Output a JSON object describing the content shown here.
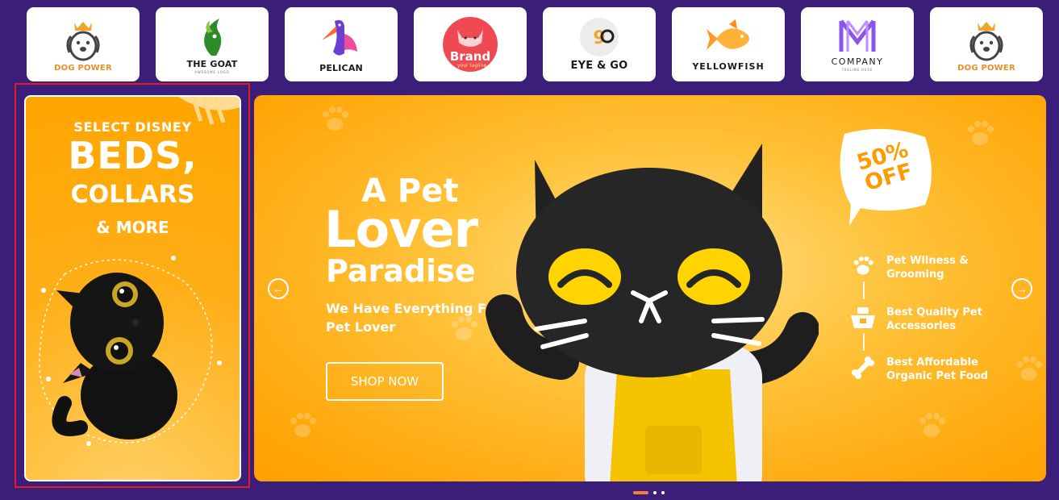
{
  "brands": [
    {
      "name": "DOG POWER",
      "tagline": "",
      "icon": "dog-crown-icon"
    },
    {
      "name": "THE GOAT",
      "tagline": "AWESOME LOGO",
      "icon": "goat-icon"
    },
    {
      "name": "PELICAN",
      "tagline": "",
      "icon": "pelican-icon"
    },
    {
      "name": "Brand",
      "tagline": "your tagline",
      "icon": "cat-face-icon"
    },
    {
      "name": "EYE & GO",
      "tagline": "",
      "icon": "eye-go-icon"
    },
    {
      "name": "YELLOWFISH",
      "tagline": "",
      "icon": "fish-icon"
    },
    {
      "name": "COMPANY",
      "tagline": "TAGLINE HERE",
      "icon": "m-logo-icon"
    },
    {
      "name": "DOG POWER",
      "tagline": "",
      "icon": "dog-crown-icon"
    }
  ],
  "side_banner": {
    "pre": "SELECT DISNEY",
    "big": "BEDS,",
    "mid": "COLLARS",
    "small": "& MORE"
  },
  "hero": {
    "line1": "A Pet",
    "line2": "Lover",
    "line3": "Paradise",
    "subtitle": "We Have Everything For Pet Lover",
    "button": "SHOP NOW",
    "badge": "50% OFF",
    "prev": "←",
    "next": "→",
    "features": [
      {
        "label": "Pet Wllness & Grooming",
        "icon": "paw-icon"
      },
      {
        "label": "Best Quality Pet Accessories",
        "icon": "food-bowl-icon"
      },
      {
        "label": "Best Affordable Organic Pet Food",
        "icon": "bone-icon"
      }
    ]
  },
  "pager": {
    "count": 3,
    "active": 0
  },
  "colors": {
    "background": "#3b1d7a",
    "accent": "#ffa500",
    "highlight": "#e01c1c",
    "dot_active": "#ff7a3d"
  }
}
